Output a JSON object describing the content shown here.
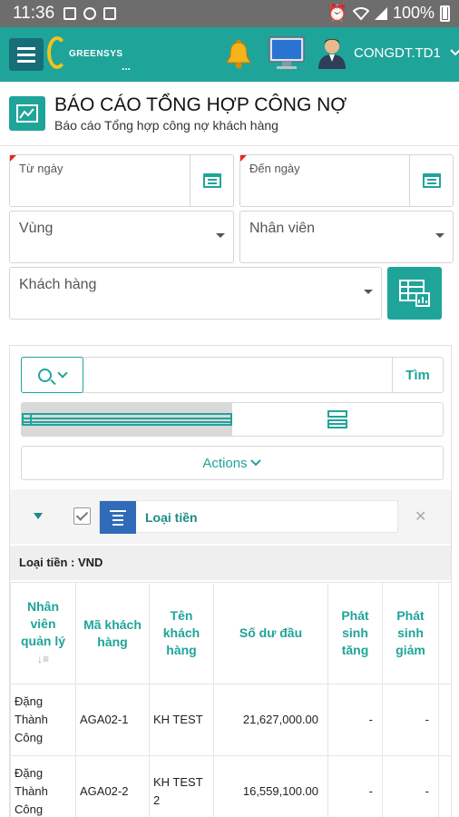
{
  "statusbar": {
    "time": "11:36",
    "battery": "100%"
  },
  "app": {
    "logo_text": "GREENSYS",
    "logo_dots": "...",
    "user_name": "CONGDT.TD1"
  },
  "page": {
    "title": "BÁO CÁO TỔNG HỢP CÔNG NỢ",
    "subtitle": "Báo cáo Tổng hợp công nợ khách hàng"
  },
  "form": {
    "from_date_label": "Từ ngày",
    "to_date_label": "Đến ngày",
    "region_label": "Vùng",
    "employee_label": "Nhân viên",
    "customer_label": "Khách hàng"
  },
  "grid": {
    "search_button": "Tìm",
    "actions_label": "Actions",
    "group_chip_label": "Loại tiền",
    "group_header": "Loại tiền : VND",
    "columns": [
      "Nhân viên quản lý",
      "Mã khách hàng",
      "Tên khách hàng",
      "Số dư đầu",
      "Phát sinh tăng",
      "Phát sinh giảm"
    ],
    "rows": [
      [
        "Đặng Thành Công",
        "AGA02-1",
        "KH TEST",
        "21,627,000.00",
        "-",
        "-"
      ],
      [
        "Đặng Thành Công",
        "AGA02-2",
        "KH TEST 2",
        "16,559,100.00",
        "-",
        "-"
      ]
    ]
  }
}
